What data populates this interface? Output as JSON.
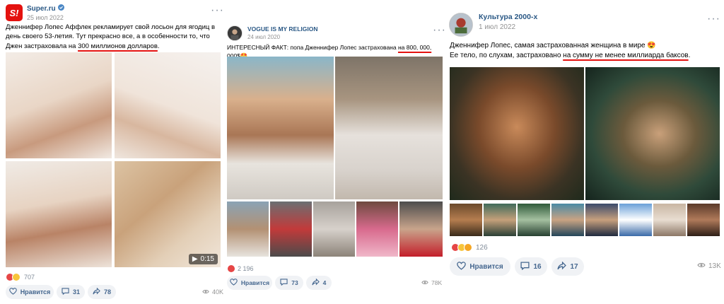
{
  "posts": [
    {
      "author": "Super.ru",
      "date": "25 июл 2022",
      "avatar_text": "S!",
      "text_before": "Дженнифер Лопес Аффлек рекламирует свой лосьон для ягодиц в день своего 53-летия. Тут прекрасно все, а в особенности то, что Джен застраховала на ",
      "text_highlight": "300 миллионов долларов",
      "text_after": ".",
      "reaction_count": "707",
      "like_label": "Нравится",
      "comments": "31",
      "shares": "78",
      "views": "40K",
      "video_duration": "0:15"
    },
    {
      "author": "VOGUE IS MY RELIGION",
      "date": "24 июл 2020",
      "text_before": "ИНТЕРЕСНЫЙ ФАКТ: попа Дженнифер Лопес застрахована ",
      "text_highlight": "на 800, 000, 000$",
      "text_after": "🤩",
      "reaction_count": "2 196",
      "like_label": "Нравится",
      "comments": "73",
      "shares": "4",
      "views": "78K"
    },
    {
      "author": "Культура 2000-х",
      "date": "1 июл 2022",
      "text_line1": "Дженнифер Лопес, самая застрахованная женщина в мире 😍",
      "text_before": "Ее тело, по слухам, застраховано ",
      "text_highlight": "на сумму не менее миллиарда баксов",
      "text_after": ".",
      "reaction_count": "126",
      "like_label": "Нравится",
      "comments": "16",
      "shares": "17",
      "views": "13K"
    }
  ],
  "colors": {
    "link": "#2a5885",
    "underline": "#e4120f",
    "brand_super": "#e4120f",
    "button_bg": "#f0f2f5",
    "secondary_text": "#818c99"
  },
  "icons": [
    "verified-icon",
    "more-dots-icon",
    "heart-icon",
    "comment-icon",
    "share-icon",
    "eye-icon",
    "play-icon"
  ]
}
